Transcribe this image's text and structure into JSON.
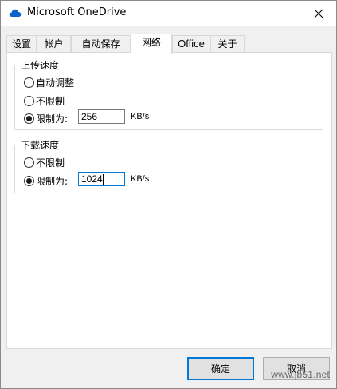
{
  "window": {
    "title": "Microsoft OneDrive",
    "app_icon": "onedrive-cloud-icon",
    "close_icon": "close-icon"
  },
  "tabs": [
    {
      "label": "设置",
      "active": false
    },
    {
      "label": "帐户",
      "active": false
    },
    {
      "label": "自动保存",
      "active": false
    },
    {
      "label": "网络",
      "active": true
    },
    {
      "label": "Office",
      "active": false
    },
    {
      "label": "关于",
      "active": false
    }
  ],
  "upload": {
    "title": "上传速度",
    "option_auto": "自动调整",
    "option_unlimited": "不限制",
    "option_limit": "限制为:",
    "selected": "limit",
    "value": "256",
    "unit": "KB/s"
  },
  "download": {
    "title": "下载速度",
    "option_unlimited": "不限制",
    "option_limit": "限制为:",
    "selected": "limit",
    "value": "1024",
    "unit": "KB/s"
  },
  "buttons": {
    "ok": "确定",
    "cancel": "取消"
  },
  "watermark": "www.jb51.net"
}
